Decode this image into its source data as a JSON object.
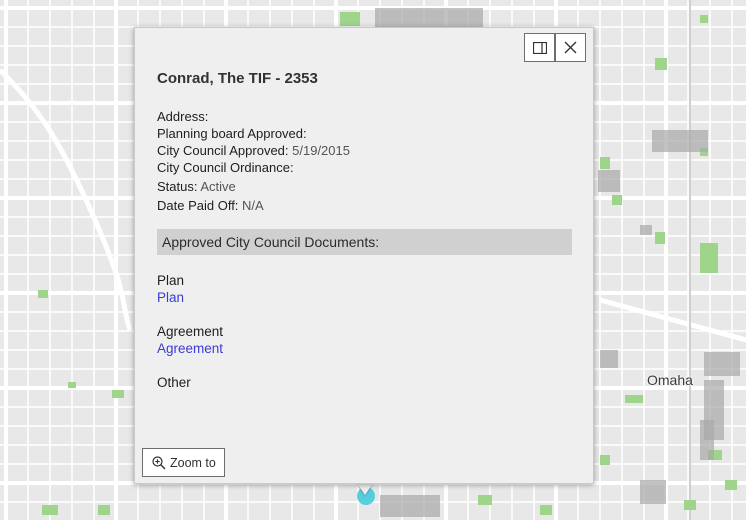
{
  "map": {
    "city_label": "Omaha",
    "colors": {
      "background": "#e8e8e8",
      "roads": "#ffffff",
      "parks": "#9ed58a",
      "buildings": "#a8a8a8",
      "marker": "#3cc8d8"
    }
  },
  "popup": {
    "title": "Conrad, The TIF - 2353",
    "dock_icon": "dock-icon",
    "close_icon": "close-icon",
    "fields": [
      {
        "label": "Address:",
        "value": ""
      },
      {
        "label": "Planning board Approved:",
        "value": ""
      },
      {
        "label": "City Council Approved:",
        "value": "5/19/2015"
      },
      {
        "label": "City Council Ordinance:",
        "value": ""
      },
      {
        "label": "Status:",
        "value": "Active"
      },
      {
        "label": "Date Paid Off:",
        "value": "N/A"
      }
    ],
    "section_title": "Approved City Council Documents:",
    "documents": [
      {
        "heading": "Plan",
        "link": "Plan"
      },
      {
        "heading": "Agreement",
        "link": "Agreement"
      },
      {
        "heading": "Other",
        "link": ""
      }
    ],
    "zoom_label": "Zoom to",
    "zoom_icon": "zoom-in-icon"
  }
}
